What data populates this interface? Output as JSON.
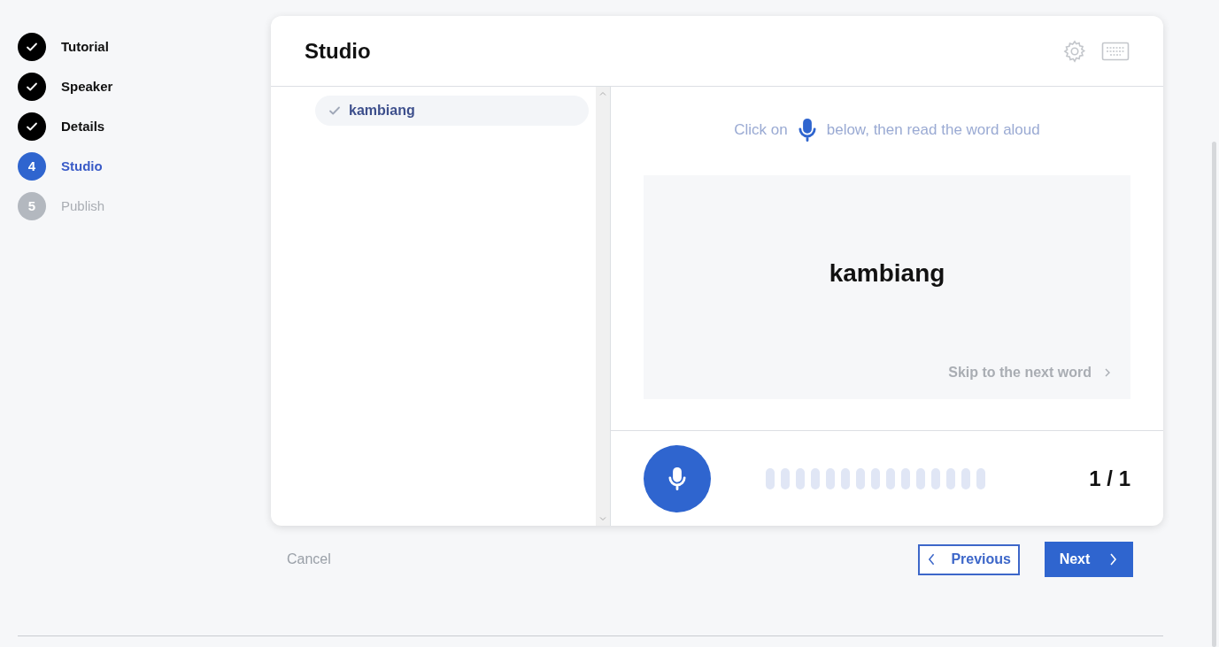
{
  "steps": [
    {
      "label": "Tutorial",
      "kind": "done"
    },
    {
      "label": "Speaker",
      "kind": "done"
    },
    {
      "label": "Details",
      "kind": "done"
    },
    {
      "label": "Studio",
      "kind": "current",
      "number": "4"
    },
    {
      "label": "Publish",
      "kind": "pending",
      "number": "5"
    }
  ],
  "studio": {
    "title": "Studio",
    "words": [
      {
        "label": "kambiang",
        "selected": true,
        "recorded": true
      }
    ],
    "instruction": {
      "before": "Click on",
      "after": "below, then read the word aloud"
    },
    "current_word": "kambiang",
    "skip_link": "Skip to the next word",
    "counter": "1 / 1"
  },
  "footer": {
    "cancel": "Cancel",
    "previous": "Previous",
    "next": "Next"
  }
}
